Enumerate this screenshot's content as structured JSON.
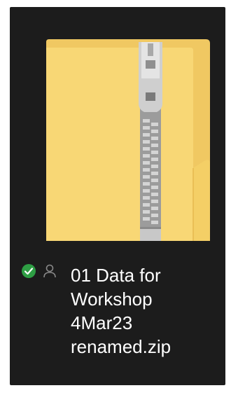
{
  "file": {
    "name_lines": [
      "01 Data for",
      "Workshop",
      "4Mar23",
      "renamed.zip"
    ],
    "icon": "zipped-folder-icon",
    "sync_status_icon": "synced-check-icon",
    "sharing_icon": "person-icon"
  },
  "colors": {
    "tile_background": "#1c1c1c",
    "folder_yellow": "#f8d775",
    "folder_back": "#e8b84a",
    "zipper_gray": "#b8b8b8",
    "sync_green": "#2e9e44",
    "text": "#ffffff"
  }
}
